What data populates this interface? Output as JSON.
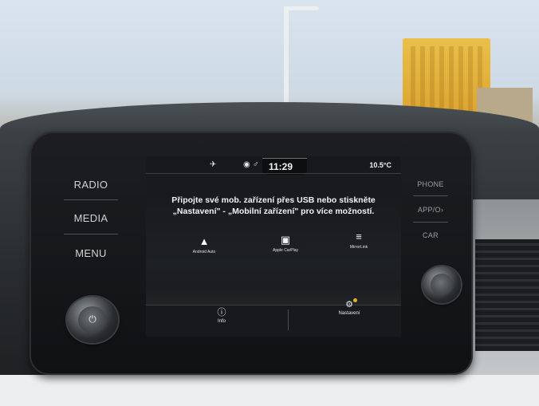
{
  "hardware_buttons": {
    "left": [
      "RADIO",
      "MEDIA",
      "MENU"
    ],
    "right": [
      "PHONE",
      "APP/O›",
      "CAR"
    ]
  },
  "status_bar": {
    "time": "11:29",
    "temperature": "10.5°C",
    "icons": [
      "nav-muted-icon",
      "speaker-icon",
      "person-icon"
    ]
  },
  "message": {
    "line1": "Připojte své mob. zařízení přes USB nebo stiskněte",
    "line2": "„Nastavení\" - „Mobilní zařízení\" pro více možností."
  },
  "apps": [
    {
      "label": "Android Auto",
      "icon": "android-auto-icon"
    },
    {
      "label": "Apple CarPlay",
      "icon": "apple-carplay-icon"
    },
    {
      "label": "MirrorLink",
      "icon": "mirrorlink-icon"
    }
  ],
  "bottom_bar": {
    "info_label": "Info",
    "settings_label": "Nastavení"
  },
  "colors": {
    "screen_bg": "#1b1d20",
    "text": "#f1f2f3",
    "settings_badge": "#e3b220"
  }
}
